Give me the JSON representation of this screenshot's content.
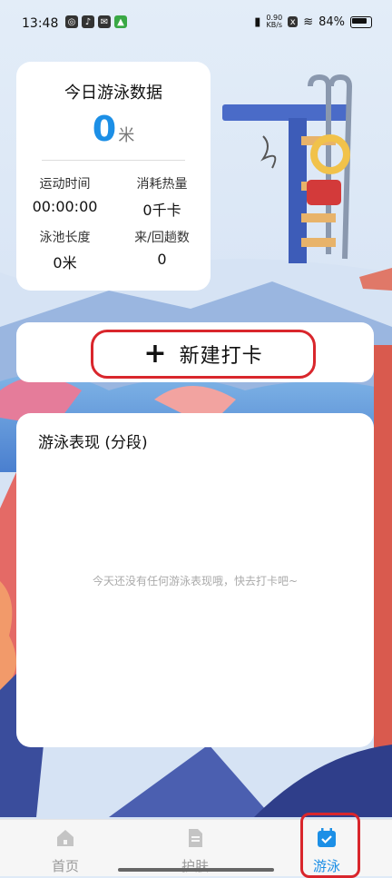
{
  "status": {
    "time": "13:48",
    "net_speed_value": "0.90",
    "net_speed_unit": "KB/s",
    "battery": "84%"
  },
  "stats": {
    "title": "今日游泳数据",
    "distance_value": "0",
    "distance_unit": "米",
    "items": [
      {
        "label": "运动时间",
        "value": "00:00:00"
      },
      {
        "label": "消耗热量",
        "value": "0千卡"
      },
      {
        "label": "泳池长度",
        "value": "0米"
      },
      {
        "label": "来/回趟数",
        "value": "0"
      }
    ]
  },
  "checkin": {
    "label": "新建打卡"
  },
  "performance": {
    "title": "游泳表现 (分段)",
    "empty_message": "今天还没有任何游泳表现哦，快去打卡吧~"
  },
  "tabs": [
    {
      "label": "首页",
      "icon": "home-icon"
    },
    {
      "label": "护肤",
      "icon": "document-icon"
    },
    {
      "label": "游泳",
      "icon": "calendar-check-icon"
    }
  ],
  "colors": {
    "accent": "#1c8fe6",
    "highlight": "#d9262c"
  }
}
